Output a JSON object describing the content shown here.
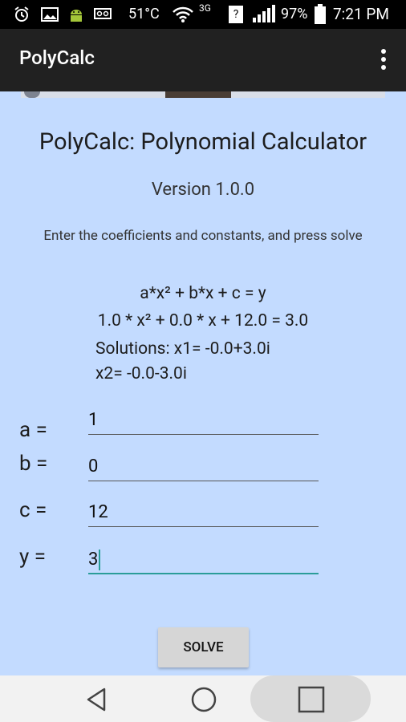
{
  "status_bar": {
    "temperature": "51°C",
    "network": "3G",
    "sim": "?",
    "battery": "97%",
    "time": "7:21 PM"
  },
  "app_bar": {
    "title": "PolyCalc"
  },
  "main": {
    "heading": "PolyCalc: Polynomial Calculator",
    "version": "Version 1.0.0",
    "instructions": "Enter the coefficients and constants, and press solve",
    "equation_template": "a*x² + b*x + c = y",
    "equation_current": "1.0 * x² + 0.0 * x + 12.0 = 3.0",
    "solutions_line1": "Solutions: x1= -0.0+3.0i",
    "solutions_line2": "x2= -0.0-3.0i"
  },
  "form": {
    "a_label": "a =",
    "a_value": "1",
    "b_label": "b =",
    "b_value": "0",
    "c_label": "c =",
    "c_value": "12",
    "y_label": "y =",
    "y_value": "3",
    "solve_label": "SOLVE"
  },
  "colors": {
    "background": "#c3dbff",
    "app_bar": "#212121",
    "accent": "#2a9d99"
  }
}
